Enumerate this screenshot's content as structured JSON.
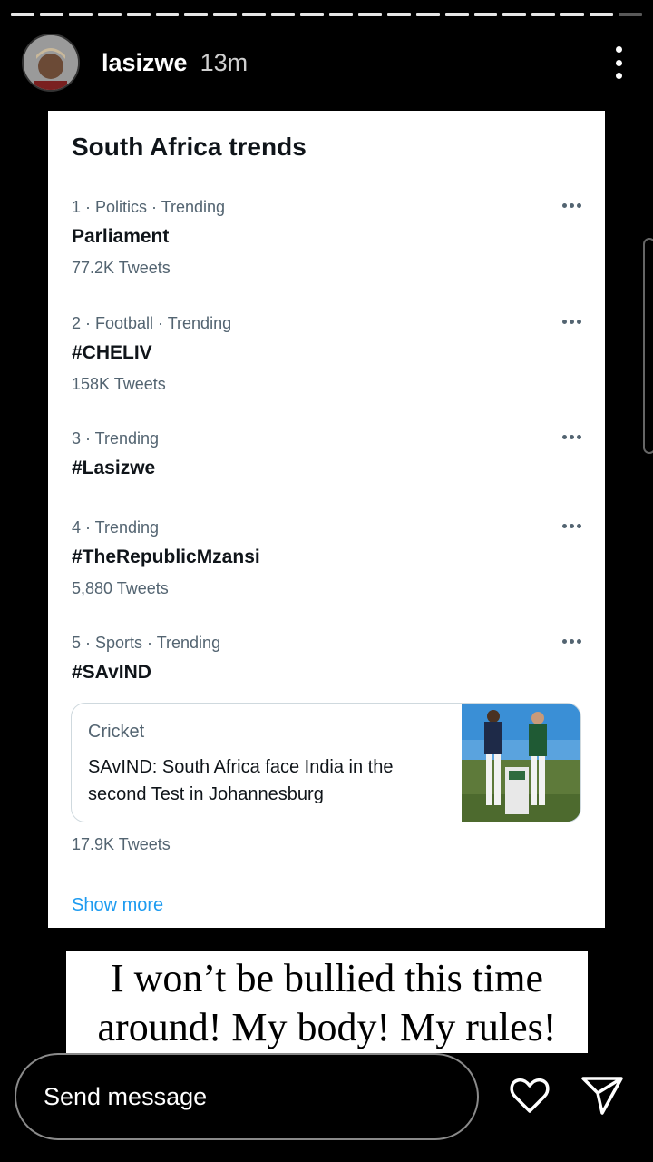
{
  "story": {
    "progress_segments_total": 22,
    "progress_segments_viewed": 21,
    "username": "lasizwe",
    "time_ago": "13m",
    "icons": {
      "more": "more-vertical-icon",
      "heart": "heart-icon",
      "send": "send-icon"
    }
  },
  "card": {
    "title": "South Africa trends",
    "trends": [
      {
        "meta": "1 · Politics · Trending",
        "name": "Parliament",
        "count": "77.2K Tweets"
      },
      {
        "meta": "2 · Football · Trending",
        "name": "#CHELIV",
        "count": "158K Tweets"
      },
      {
        "meta": "3 · Trending",
        "name": "#Lasizwe",
        "count": ""
      },
      {
        "meta": "4 · Trending",
        "name": "#TheRepublicMzansi",
        "count": "5,880 Tweets"
      },
      {
        "meta": "5 · Sports · Trending",
        "name": "#SAvIND",
        "count": ""
      }
    ],
    "news": {
      "category": "Cricket",
      "headline": "SAvIND: South Africa face India in the second Test in Johannesburg",
      "count": "17.9K Tweets"
    },
    "show_more": "Show more",
    "colors": {
      "link": "#1d9bf0",
      "secondary_text": "#536471"
    }
  },
  "caption": {
    "line1": "I won’t be bullied this time",
    "line2": "around! My body! My rules!"
  },
  "footer": {
    "message_placeholder": "Send message"
  }
}
